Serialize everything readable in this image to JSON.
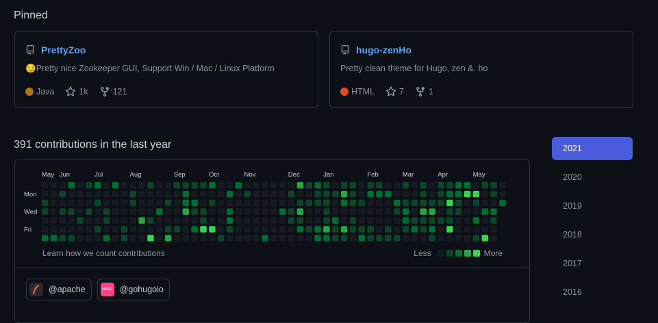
{
  "pinned": {
    "title": "Pinned",
    "repos": [
      {
        "name": "PrettyZoo",
        "emoji": "😏",
        "description": "Pretty nice Zookeeper GUI, Support Win / Mac / Linux Platform",
        "language": "Java",
        "language_color": "#b07219",
        "stars": "1k",
        "forks": "121"
      },
      {
        "name": "hugo-zenHo",
        "emoji": "",
        "description": "Pretty clean theme for Hugo, zen &. ho",
        "language": "HTML",
        "language_color": "#e34c26",
        "stars": "7",
        "forks": "1"
      }
    ]
  },
  "contributions": {
    "title": "391 contributions in the last year",
    "months": [
      "May",
      "Jun",
      "Jul",
      "Aug",
      "Sep",
      "Oct",
      "Nov",
      "Dec",
      "Jan",
      "Feb",
      "Mar",
      "Apr",
      "May"
    ],
    "day_labels": [
      "Mon",
      "Wed",
      "Fri"
    ],
    "learn_link": "Learn how we count contributions",
    "legend_less": "Less",
    "legend_more": "More",
    "colors": [
      "#161b22",
      "#0e4429",
      "#006d32",
      "#26a641",
      "#39d353"
    ]
  },
  "organizations": [
    {
      "handle": "@apache",
      "icon": "feather-icon"
    },
    {
      "handle": "@gohugoio",
      "icon": "hugo-icon",
      "badge": "HUGO"
    }
  ],
  "years": [
    "2021",
    "2020",
    "2019",
    "2018",
    "2017",
    "2016"
  ],
  "active_year": "2021"
}
